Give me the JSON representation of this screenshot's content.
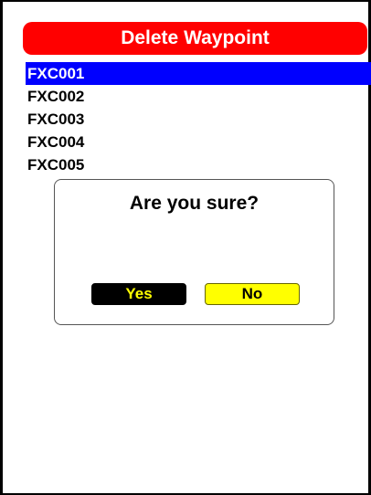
{
  "screen": {
    "title": "Delete Waypoint"
  },
  "waypoints": [
    {
      "label": "FXC001",
      "selected": true
    },
    {
      "label": "FXC002",
      "selected": false
    },
    {
      "label": "FXC003",
      "selected": false
    },
    {
      "label": "FXC004",
      "selected": false
    },
    {
      "label": "FXC005",
      "selected": false
    }
  ],
  "dialog": {
    "message": "Are you sure?",
    "yes_label": "Yes",
    "no_label": "No"
  },
  "colors": {
    "title_bar": "#ff0000",
    "selection": "#0000ff",
    "yes_button_bg": "#000000",
    "yes_button_text": "#ffff00",
    "no_button_bg": "#ffff00"
  }
}
